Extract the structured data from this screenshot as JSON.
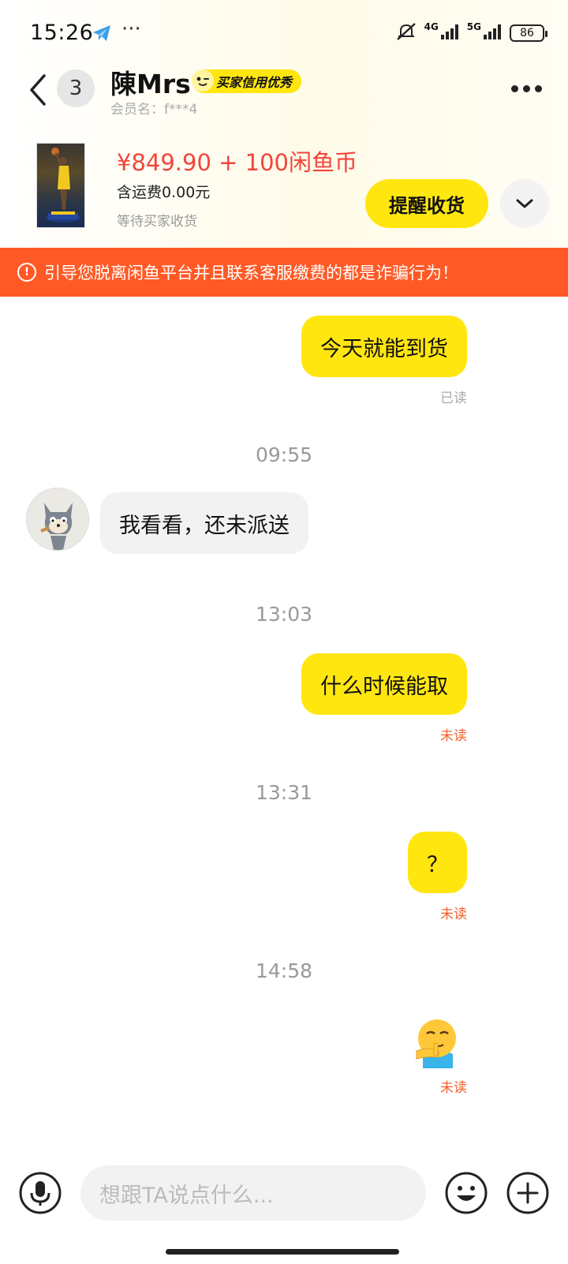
{
  "status_bar": {
    "time": "15:26",
    "dots": "···",
    "net_4g": "4G",
    "net_5g": "5G",
    "battery": "86"
  },
  "header": {
    "unread_count": "3",
    "contact_name": "陳Mrs",
    "credit_badge": "买家信用优秀",
    "member_label": "会员名：f***4"
  },
  "product": {
    "price": "¥849.90 + 100闲鱼币",
    "shipping": "含运费0.00元",
    "status": "等待买家收货",
    "remind_button": "提醒收货"
  },
  "warning": {
    "text": "引导您脱离闲鱼平台并且联系客服缴费的都是诈骗行为！",
    "icon_glyph": "!"
  },
  "chat": {
    "messages": [
      {
        "text": "今天就能到货",
        "status": "已读"
      },
      {
        "time": "09:55"
      },
      {
        "text": "我看看，还未派送"
      },
      {
        "time": "13:03"
      },
      {
        "text": "什么时候能取",
        "status": "未读"
      },
      {
        "time": "13:31"
      },
      {
        "text": "？",
        "status": "未读"
      },
      {
        "time": "14:58"
      },
      {
        "sticker": "shushing-face-sticker",
        "status": "未读"
      }
    ]
  },
  "input": {
    "placeholder": "想跟TA说点什么..."
  },
  "colors": {
    "accent_yellow": "#ffe60f",
    "warning_orange": "#ff5a26",
    "price_red": "#f2453a",
    "unread_orange": "#f2622e"
  }
}
